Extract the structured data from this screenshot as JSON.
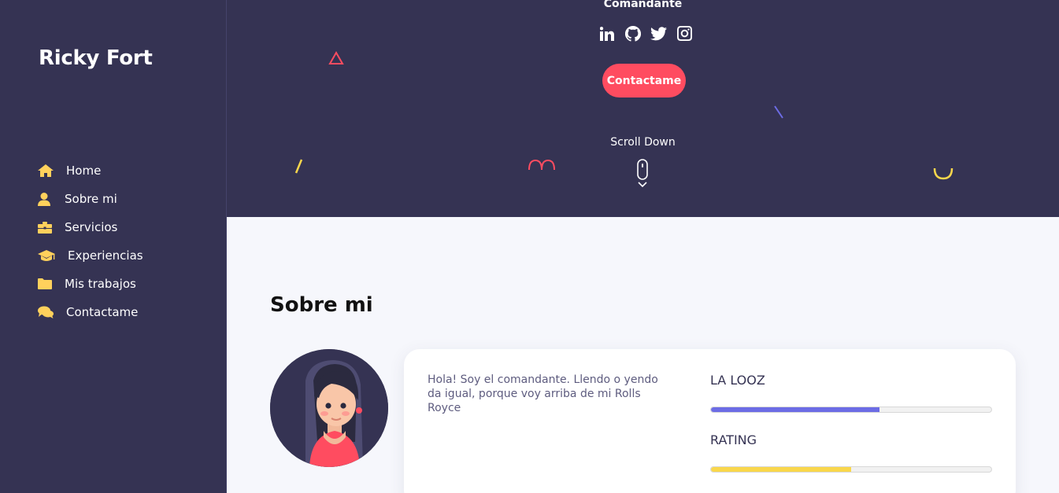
{
  "sidebar": {
    "brand": "Ricky Fort",
    "items": [
      {
        "label": "Home",
        "icon": "home-icon"
      },
      {
        "label": "Sobre mi",
        "icon": "user-icon"
      },
      {
        "label": "Servicios",
        "icon": "briefcase-icon"
      },
      {
        "label": "Experiencias",
        "icon": "graduation-cap-icon"
      },
      {
        "label": "Mis trabajos",
        "icon": "folder-icon"
      },
      {
        "label": "Contactame",
        "icon": "comments-icon"
      }
    ]
  },
  "hero": {
    "name": "Comandante",
    "socials": [
      "linkedin-icon",
      "github-icon",
      "twitter-icon",
      "instagram-icon"
    ],
    "contact_button": "Contactame",
    "scroll_label": "Scroll Down"
  },
  "about": {
    "title": "Sobre mi",
    "bio": "Hola! Soy el comandante. Llendo o yendo da igual, porque voy arriba de mi Rolls Royce",
    "skills": [
      {
        "label": "LA LOOZ",
        "value": 60,
        "color": "#6c6ce5"
      },
      {
        "label": "RATING",
        "value": 50,
        "color": "#f9d74c"
      }
    ]
  },
  "colors": {
    "dark": "#353353",
    "accent": "#ff4c60",
    "icon_yellow": "#ffd15c",
    "background": "#f6f7fc"
  }
}
